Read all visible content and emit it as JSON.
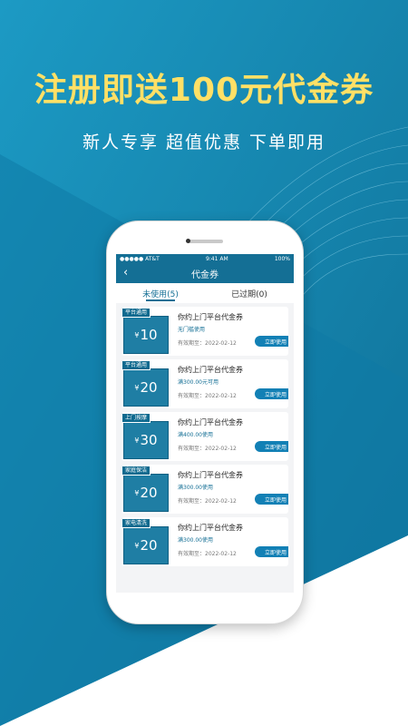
{
  "headline": "注册即送100元代金券",
  "subline": "新人专享  超值优惠  下单即用",
  "phone": {
    "status": {
      "carrier": "●●●●● AT&T",
      "time": "9:41 AM",
      "battery": "100%"
    },
    "nav": {
      "back_icon": "‹",
      "title": "代金券"
    },
    "tabs": [
      {
        "label": "未使用(5)",
        "active": true
      },
      {
        "label": "已过期(0)",
        "active": false
      }
    ],
    "coupons": [
      {
        "tag": "平台通用",
        "currency": "¥",
        "amount": "10",
        "title": "你约上门平台代金券",
        "condition": "无门槛使用",
        "valid": "有效期至：2022-02-12",
        "button": "立即使用"
      },
      {
        "tag": "平台通用",
        "currency": "¥",
        "amount": "20",
        "title": "你约上门平台代金券",
        "condition": "满300.00元可用",
        "valid": "有效期至：2022-02-12",
        "button": "立即使用"
      },
      {
        "tag": "上门按摩",
        "currency": "¥",
        "amount": "30",
        "title": "你约上门平台代金券",
        "condition": "满400.00使用",
        "valid": "有效期至：2022-02-12",
        "button": "立即使用"
      },
      {
        "tag": "家庭保洁",
        "currency": "¥",
        "amount": "20",
        "title": "你约上门平台代金券",
        "condition": "满300.00使用",
        "valid": "有效期至：2022-02-12",
        "button": "立即使用"
      },
      {
        "tag": "家电清洗",
        "currency": "¥",
        "amount": "20",
        "title": "你约上门平台代金券",
        "condition": "满300.00使用",
        "valid": "有效期至：2022-02-12",
        "button": "立即使用"
      }
    ]
  },
  "colors": {
    "primary": "#146f95",
    "accent": "#ffe066",
    "button": "#1280b5"
  }
}
